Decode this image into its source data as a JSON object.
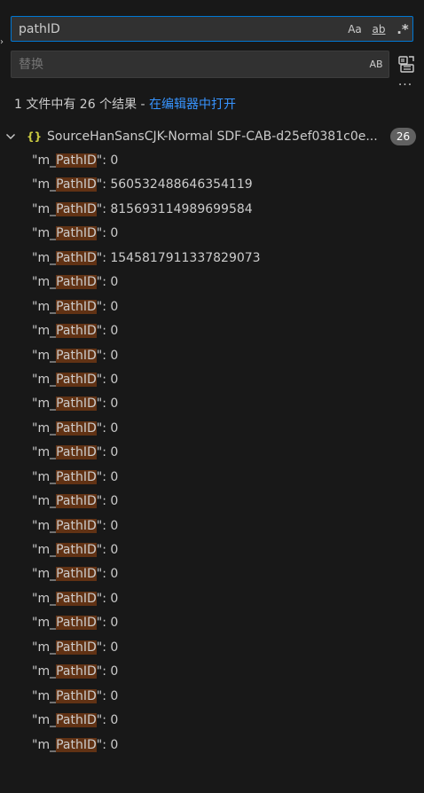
{
  "search": {
    "query": "pathID",
    "match_case_label": "Aa",
    "whole_word_label": "ab",
    "regex_label": ".*"
  },
  "replace": {
    "placeholder": "替换",
    "preserve_case_label": "AB"
  },
  "summary": {
    "text": "1 文件中有 26 个结果",
    "separator": " - ",
    "open_in_editor": "在编辑器中打开"
  },
  "file": {
    "icon": "{}",
    "name": "SourceHanSansCJK-Normal SDF-CAB-d25ef0381c0e...",
    "count": "26"
  },
  "results": [
    {
      "prefix": "\"m_",
      "match": "PathID",
      "suffix": "\": 0"
    },
    {
      "prefix": "\"m_",
      "match": "PathID",
      "suffix": "\": 560532488646354119"
    },
    {
      "prefix": "\"m_",
      "match": "PathID",
      "suffix": "\": 815693114989699584"
    },
    {
      "prefix": "\"m_",
      "match": "PathID",
      "suffix": "\": 0"
    },
    {
      "prefix": "\"m_",
      "match": "PathID",
      "suffix": "\": 1545817911337829073"
    },
    {
      "prefix": "\"m_",
      "match": "PathID",
      "suffix": "\": 0"
    },
    {
      "prefix": "\"m_",
      "match": "PathID",
      "suffix": "\": 0"
    },
    {
      "prefix": "\"m_",
      "match": "PathID",
      "suffix": "\": 0"
    },
    {
      "prefix": "\"m_",
      "match": "PathID",
      "suffix": "\": 0"
    },
    {
      "prefix": "\"m_",
      "match": "PathID",
      "suffix": "\": 0"
    },
    {
      "prefix": "\"m_",
      "match": "PathID",
      "suffix": "\": 0"
    },
    {
      "prefix": "\"m_",
      "match": "PathID",
      "suffix": "\": 0"
    },
    {
      "prefix": "\"m_",
      "match": "PathID",
      "suffix": "\": 0"
    },
    {
      "prefix": "\"m_",
      "match": "PathID",
      "suffix": "\": 0"
    },
    {
      "prefix": "\"m_",
      "match": "PathID",
      "suffix": "\": 0"
    },
    {
      "prefix": "\"m_",
      "match": "PathID",
      "suffix": "\": 0"
    },
    {
      "prefix": "\"m_",
      "match": "PathID",
      "suffix": "\": 0"
    },
    {
      "prefix": "\"m_",
      "match": "PathID",
      "suffix": "\": 0"
    },
    {
      "prefix": "\"m_",
      "match": "PathID",
      "suffix": "\": 0"
    },
    {
      "prefix": "\"m_",
      "match": "PathID",
      "suffix": "\": 0"
    },
    {
      "prefix": "\"m_",
      "match": "PathID",
      "suffix": "\": 0"
    },
    {
      "prefix": "\"m_",
      "match": "PathID",
      "suffix": "\": 0"
    },
    {
      "prefix": "\"m_",
      "match": "PathID",
      "suffix": "\": 0"
    },
    {
      "prefix": "\"m_",
      "match": "PathID",
      "suffix": "\": 0"
    },
    {
      "prefix": "\"m_",
      "match": "PathID",
      "suffix": "\": 0"
    }
  ],
  "colors": {
    "background": "#181818",
    "focus_border": "#0078d4",
    "match_highlight": "#613214",
    "link": "#3794ff",
    "json_icon": "#cbcb41",
    "badge": "#616161"
  }
}
